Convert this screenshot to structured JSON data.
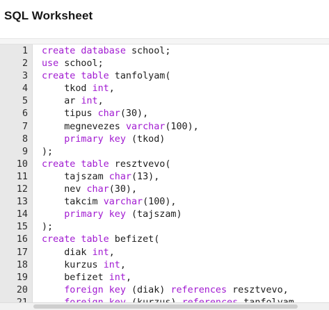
{
  "worksheet": {
    "title": "SQL Worksheet"
  },
  "colors": {
    "keyword": "#a11ad1",
    "text": "#1c1c1c",
    "gutter": "#e8e8e8"
  },
  "editor": {
    "lines": [
      {
        "num": "1",
        "tokens": [
          {
            "t": "create database",
            "kw": true
          },
          {
            "t": " school;",
            "kw": false
          }
        ]
      },
      {
        "num": "2",
        "tokens": [
          {
            "t": "use",
            "kw": true
          },
          {
            "t": " school;",
            "kw": false
          }
        ]
      },
      {
        "num": "3",
        "tokens": [
          {
            "t": "create table",
            "kw": true
          },
          {
            "t": " tanfolyam(",
            "kw": false
          }
        ]
      },
      {
        "num": "4",
        "tokens": [
          {
            "t": "    tkod ",
            "kw": false
          },
          {
            "t": "int",
            "kw": true
          },
          {
            "t": ",",
            "kw": false
          }
        ]
      },
      {
        "num": "5",
        "tokens": [
          {
            "t": "    ar ",
            "kw": false
          },
          {
            "t": "int",
            "kw": true
          },
          {
            "t": ",",
            "kw": false
          }
        ]
      },
      {
        "num": "6",
        "tokens": [
          {
            "t": "    tipus ",
            "kw": false
          },
          {
            "t": "char",
            "kw": true
          },
          {
            "t": "(30),",
            "kw": false
          }
        ]
      },
      {
        "num": "7",
        "tokens": [
          {
            "t": "    megnevezes ",
            "kw": false
          },
          {
            "t": "varchar",
            "kw": true
          },
          {
            "t": "(100),",
            "kw": false
          }
        ]
      },
      {
        "num": "8",
        "tokens": [
          {
            "t": "    ",
            "kw": false
          },
          {
            "t": "primary key",
            "kw": true
          },
          {
            "t": " (tkod)",
            "kw": false
          }
        ]
      },
      {
        "num": "9",
        "tokens": [
          {
            "t": ");",
            "kw": false
          }
        ]
      },
      {
        "num": "10",
        "tokens": [
          {
            "t": "create table",
            "kw": true
          },
          {
            "t": " resztvevo(",
            "kw": false
          }
        ]
      },
      {
        "num": "11",
        "tokens": [
          {
            "t": "    tajszam ",
            "kw": false
          },
          {
            "t": "char",
            "kw": true
          },
          {
            "t": "(13),",
            "kw": false
          }
        ]
      },
      {
        "num": "12",
        "tokens": [
          {
            "t": "    nev ",
            "kw": false
          },
          {
            "t": "char",
            "kw": true
          },
          {
            "t": "(30),",
            "kw": false
          }
        ]
      },
      {
        "num": "13",
        "tokens": [
          {
            "t": "    takcim ",
            "kw": false
          },
          {
            "t": "varchar",
            "kw": true
          },
          {
            "t": "(100),",
            "kw": false
          }
        ]
      },
      {
        "num": "14",
        "tokens": [
          {
            "t": "    ",
            "kw": false
          },
          {
            "t": "primary key",
            "kw": true
          },
          {
            "t": " (tajszam)",
            "kw": false
          }
        ]
      },
      {
        "num": "15",
        "tokens": [
          {
            "t": ");",
            "kw": false
          }
        ]
      },
      {
        "num": "16",
        "tokens": [
          {
            "t": "create table",
            "kw": true
          },
          {
            "t": " befizet(",
            "kw": false
          }
        ]
      },
      {
        "num": "17",
        "tokens": [
          {
            "t": "    diak ",
            "kw": false
          },
          {
            "t": "int",
            "kw": true
          },
          {
            "t": ",",
            "kw": false
          }
        ]
      },
      {
        "num": "18",
        "tokens": [
          {
            "t": "    kurzus ",
            "kw": false
          },
          {
            "t": "int",
            "kw": true
          },
          {
            "t": ",",
            "kw": false
          }
        ]
      },
      {
        "num": "19",
        "tokens": [
          {
            "t": "    befizet ",
            "kw": false
          },
          {
            "t": "int",
            "kw": true
          },
          {
            "t": ",",
            "kw": false
          }
        ]
      },
      {
        "num": "20",
        "tokens": [
          {
            "t": "    ",
            "kw": false
          },
          {
            "t": "foreign key",
            "kw": true
          },
          {
            "t": " (diak) ",
            "kw": false
          },
          {
            "t": "references",
            "kw": true
          },
          {
            "t": " resztvevo,",
            "kw": false
          }
        ]
      },
      {
        "num": "21",
        "tokens": [
          {
            "t": "    ",
            "kw": false
          },
          {
            "t": "foreign key",
            "kw": true
          },
          {
            "t": " (kurzus) ",
            "kw": false
          },
          {
            "t": "references",
            "kw": true
          },
          {
            "t": " tanfolyam",
            "kw": false
          }
        ]
      }
    ]
  }
}
